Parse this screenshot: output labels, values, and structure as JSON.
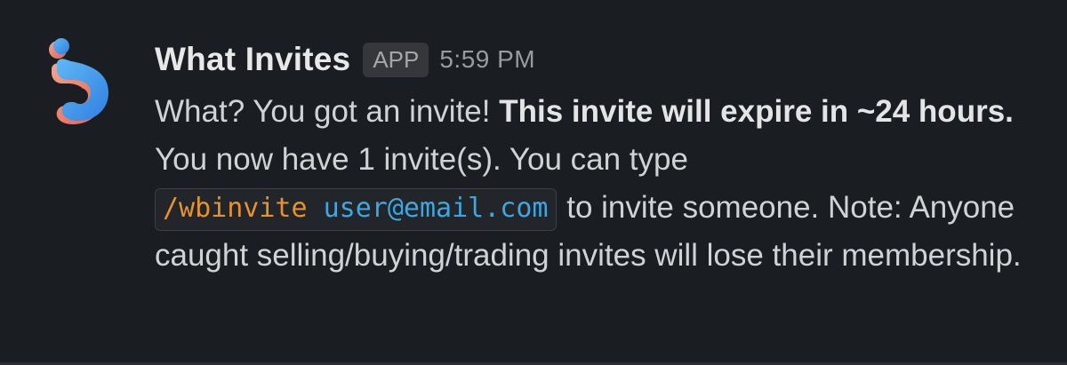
{
  "message": {
    "sender_name": "What Invites",
    "badge_label": "APP",
    "timestamp": "5:59 PM",
    "avatar_icon": "what-invites-logo-icon",
    "text": {
      "part1": "What? You got an invite! ",
      "bold": "This invite will expire in ~24 hours.",
      "part2": " You now have 1 invite(s). You can type ",
      "code_command": "/wbinvite",
      "code_space": " ",
      "code_argument": "user@email.com",
      "part3": " to invite someone. Note: Anyone caught selling/buying/trading invites will lose their membership."
    }
  },
  "colors": {
    "background": "#1a1d21",
    "text": "#d1d2d3",
    "code_command": "#e8912d",
    "code_argument": "#3ea6e0"
  }
}
